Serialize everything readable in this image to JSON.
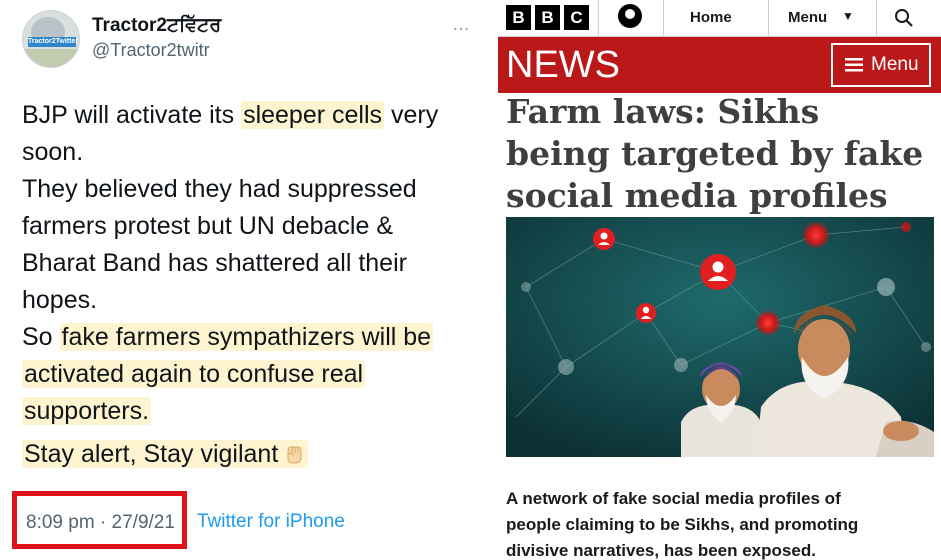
{
  "tweet": {
    "display_name": "Tractor2ਟਵਿੱਟਰ",
    "handle": "@Tractor2twitr",
    "avatar_plate_text": "Tractor2Twitter",
    "more_icon": "…",
    "body": {
      "line1_a": "BJP will activate its ",
      "line1_hl": "sleeper cells",
      "line1_b": " very",
      "line2": "soon.",
      "line3": "They believed they had suppressed",
      "line4": "farmers protest but UN debacle &",
      "line5": "Bharat Band has shattered all their",
      "line6": "hopes.",
      "line7_a": "So ",
      "line7_hl": "fake farmers sympathizers will be",
      "line8_hl": "activated again to confuse real",
      "line9_hl": "supporters.",
      "line10_hl": "Stay alert, Stay vigilant"
    },
    "emoji_icon": "raised-fist-icon",
    "timestamp": "8:09 pm · 27/9/21",
    "source": "Twitter for iPhone",
    "colors": {
      "highlight": "#fff4d0",
      "annotation_box": "#e0131a",
      "link": "#1d9bf0",
      "secondary_text": "#536471"
    }
  },
  "bbc": {
    "logo_letters": [
      "B",
      "B",
      "C"
    ],
    "home_label": "Home",
    "menu_label": "Menu",
    "news_logo": "NEWS",
    "news_menu_label": "Menu",
    "headline_lines": [
      "Farm laws: Sikhs",
      "being targeted by fake",
      "social media profiles"
    ],
    "caption_lines": [
      "A network of fake social media profiles of",
      "people claiming to be Sikhs, and promoting",
      "divisive narratives, has been exposed."
    ],
    "illustration_name": "network-of-profiles-with-sikh-men-illustration",
    "colors": {
      "news_red": "#bb1919",
      "headline": "#3f3f42",
      "illustration_bg": "#12454a"
    }
  }
}
